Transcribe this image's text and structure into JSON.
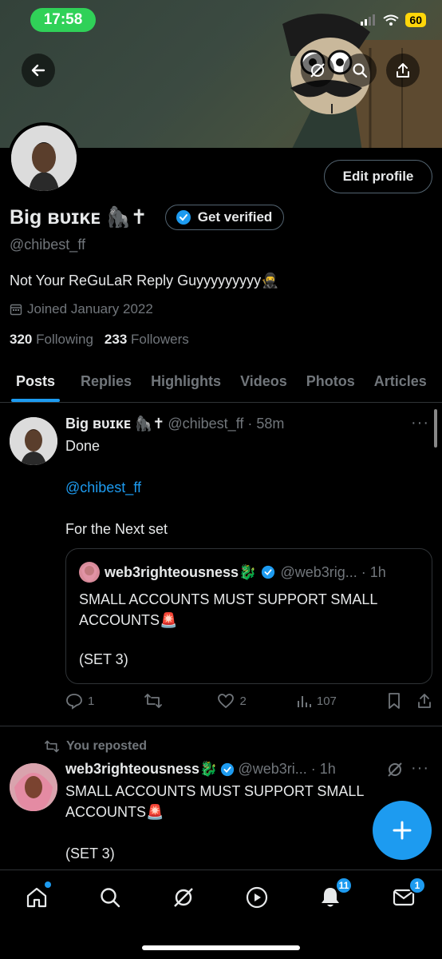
{
  "status": {
    "time": "17:58",
    "battery": "60"
  },
  "profile": {
    "name": "Big ʙᴜɪᴋᴇ 🦍✝",
    "verify_label": "Get verified",
    "handle": "@chibest_ff",
    "bio": "Not Your ReGuLaR Reply Guyyyyyyyyy🥷",
    "joined": "Joined January 2022",
    "following_count": "320",
    "following_label": "Following",
    "followers_count": "233",
    "followers_label": "Followers",
    "edit_label": "Edit profile"
  },
  "tabs": [
    "Posts",
    "Replies",
    "Highlights",
    "Videos",
    "Photos",
    "Articles"
  ],
  "post1": {
    "name": "Big ʙᴜɪᴋᴇ 🦍✝",
    "meta": "@chibest_ff · 58m",
    "line1": "Done",
    "mention": "@chibest_ff",
    "line3": "For the Next set",
    "quote": {
      "name": "web3righteousness🐉",
      "meta": "@web3rig... · 1h",
      "text1": "SMALL ACCOUNTS MUST SUPPORT SMALL ACCOUNTS🚨",
      "text2": "(SET 3)"
    },
    "replies": "1",
    "reposts": "",
    "likes": "2",
    "views": "107"
  },
  "post2": {
    "repost_label": "You reposted",
    "name": "web3righteousness🐉",
    "meta": "@web3ri... · 1h",
    "text1": "SMALL ACCOUNTS MUST SUPPORT SMALL ACCOUNTS🚨",
    "text2": "(SET 3)"
  },
  "nav": {
    "notifications_badge": "11",
    "messages_badge": "1"
  },
  "colors": {
    "accent": "#1d9bf0",
    "muted": "#71767b",
    "border": "#2f3336"
  }
}
